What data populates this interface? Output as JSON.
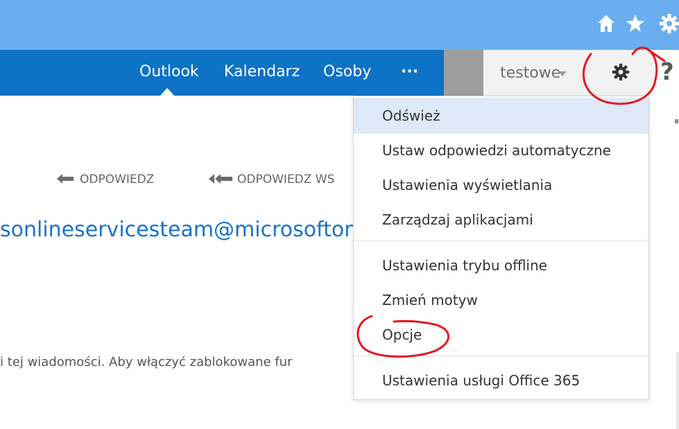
{
  "browser": {
    "icons": [
      "home-icon",
      "star-icon",
      "gear-icon"
    ]
  },
  "nav": {
    "items": [
      {
        "label": "Outlook",
        "active": true
      },
      {
        "label": "Kalendarz"
      },
      {
        "label": "Osoby"
      },
      {
        "label": "···"
      }
    ]
  },
  "user": {
    "name": "testowe"
  },
  "help": {
    "label": "?"
  },
  "message": {
    "reply_label": "ODPOWIEDZ",
    "reply_all_label": "ODPOWIEDZ WS",
    "sender_email": "sonlineservicesteam@microsofton",
    "info_text": "i tej wiadomości. Aby włączyć zablokowane fur"
  },
  "settings_menu": {
    "items": [
      {
        "label": "Odśwież",
        "highlighted": true
      },
      {
        "label": "Ustaw odpowiedzi automatyczne"
      },
      {
        "label": "Ustawienia wyświetlania"
      },
      {
        "label": "Zarządzaj aplikacjami"
      },
      {
        "label": "Ustawienia trybu offline"
      },
      {
        "label": "Zmień motyw"
      },
      {
        "label": "Opcje"
      },
      {
        "label": "Ustawienia usługi Office 365"
      }
    ]
  },
  "colors": {
    "browser_bar": "#6aaef0",
    "nav_bar": "#0e72c6",
    "link": "#1a73c8",
    "menu_highlight": "#dde9f7",
    "annotation": "#e8141b"
  }
}
